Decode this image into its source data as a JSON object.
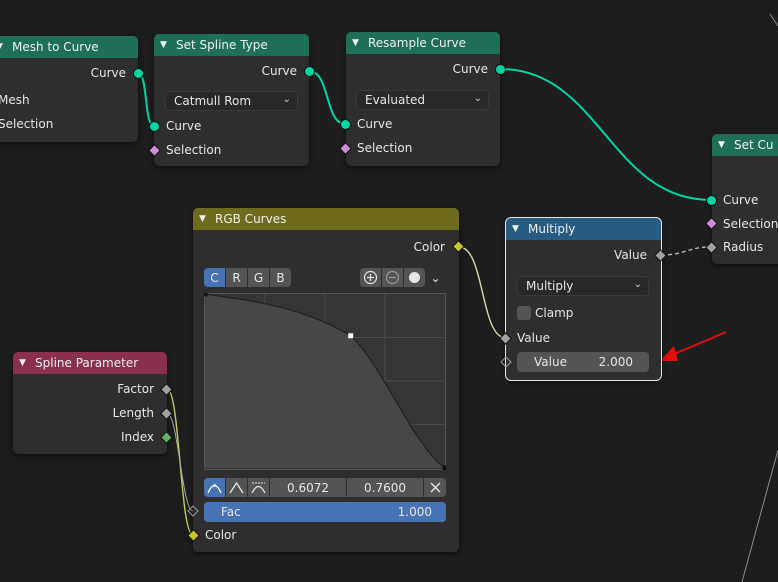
{
  "nodes": {
    "mesh_to_curve": {
      "title": "Mesh to Curve",
      "out_curve": "Curve",
      "in_mesh": "Mesh",
      "in_selection": "Selection"
    },
    "set_spline_type": {
      "title": "Set Spline Type",
      "out_curve": "Curve",
      "type_value": "Catmull Rom",
      "in_curve": "Curve",
      "in_selection": "Selection"
    },
    "resample_curve": {
      "title": "Resample Curve",
      "out_curve": "Curve",
      "mode_value": "Evaluated",
      "in_curve": "Curve",
      "in_selection": "Selection"
    },
    "set_curve": {
      "title": "Set Cu",
      "in_curve": "Curve",
      "in_selection": "Selection",
      "in_radius": "Radius"
    },
    "rgb_curves": {
      "title": "RGB Curves",
      "out_color": "Color",
      "channels": [
        "C",
        "R",
        "G",
        "B"
      ],
      "active_channel": "C",
      "point_x": "0.6072",
      "point_y": "0.7600",
      "fac_label": "Fac",
      "fac_value": "1.000",
      "fac_fraction": 1.0,
      "in_color": "Color",
      "curve_points": [
        [
          0,
          1
        ],
        [
          0.6072,
          0.76
        ],
        [
          1,
          0
        ]
      ]
    },
    "multiply": {
      "title": "Multiply",
      "out_value": "Value",
      "operation": "Multiply",
      "clamp_label": "Clamp",
      "clamp_checked": false,
      "in_value": "Value",
      "value_label": "Value",
      "value_value": "2.000"
    },
    "spline_parameter": {
      "title": "Spline Parameter",
      "out_factor": "Factor",
      "out_length": "Length",
      "out_index": "Index"
    }
  },
  "colors": {
    "geometry_header": "#1f6e58",
    "color_header": "#6e6b1c",
    "math_header": "#275b82",
    "input_header": "#8a2f4c",
    "geometry_socket": "#00d6a3",
    "color_socket": "#c7c729",
    "float_socket": "#a1a1a1",
    "bool_socket": "#cc8fd6",
    "int_socket": "#62b065",
    "annotation_arrow": "#e01010",
    "accent_blue": "#4772b3"
  },
  "icons": {
    "header_chevron": "chevron-down-icon",
    "zoom_in": "zoom-in-icon",
    "zoom_out": "zoom-out-icon",
    "clip": "clip-dot-icon",
    "menu": "chevron-down-icon",
    "delete": "x-icon",
    "handle_types": [
      "auto-handle-icon",
      "vector-handle-icon",
      "auto-clamped-handle-icon"
    ]
  }
}
